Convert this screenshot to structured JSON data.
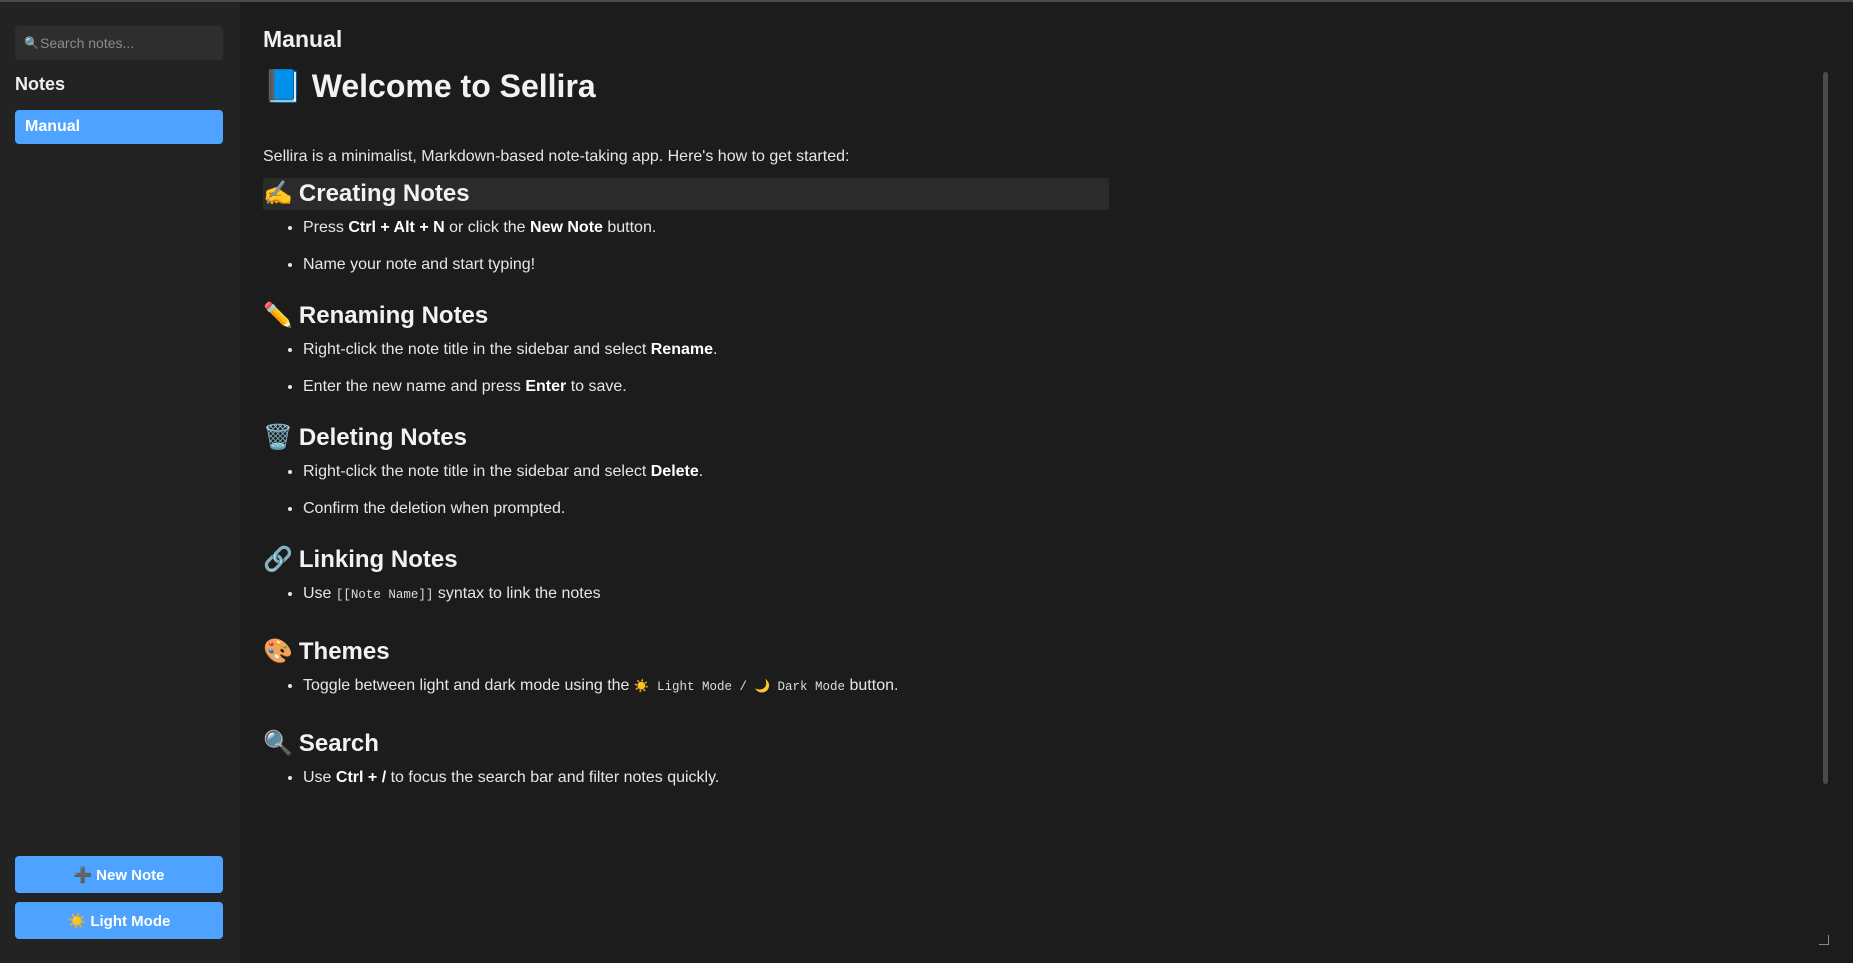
{
  "sidebar": {
    "search": {
      "placeholder": "Search notes...",
      "icon": "search-icon"
    },
    "heading": "Notes",
    "notes": [
      {
        "label": "Manual",
        "active": true
      }
    ],
    "new_note_button": {
      "icon": "plus-icon",
      "glyph": "➕",
      "label": "New Note"
    },
    "theme_button": {
      "icon": "sun-icon",
      "glyph": "☀️",
      "label": "Light Mode"
    }
  },
  "main": {
    "title": "Manual",
    "document": {
      "h1_glyph": "📘",
      "h1": "Welcome to Sellira",
      "intro": "Sellira is a minimalist, Markdown-based note-taking app. Here's how to get started:",
      "sections": [
        {
          "glyph": "✍️",
          "heading": "Creating Notes",
          "items": [
            [
              "Press ",
              {
                "b": "Ctrl + Alt + N"
              },
              " or click the ",
              {
                "b": "New Note"
              },
              " button."
            ],
            [
              "Name your note and start typing!"
            ]
          ]
        },
        {
          "glyph": "✏️",
          "heading": "Renaming Notes",
          "items": [
            [
              "Right-click the note title in the sidebar and select ",
              {
                "b": "Rename"
              },
              "."
            ],
            [
              "Enter the new name and press ",
              {
                "b": "Enter"
              },
              " to save."
            ]
          ]
        },
        {
          "glyph": "🗑️",
          "heading": "Deleting Notes",
          "items": [
            [
              "Right-click the note title in the sidebar and select ",
              {
                "b": "Delete"
              },
              "."
            ],
            [
              "Confirm the deletion when prompted."
            ]
          ]
        },
        {
          "glyph": "🔗",
          "heading": "Linking Notes",
          "items": [
            [
              "Use ",
              {
                "code": "[[Note Name]]"
              },
              " syntax to link the notes"
            ]
          ]
        },
        {
          "glyph": "🎨",
          "heading": "Themes",
          "items": [
            [
              "Toggle between light and dark mode using the ",
              {
                "code": "☀️ Light Mode / 🌙 Dark Mode"
              },
              " button."
            ]
          ]
        },
        {
          "glyph": "🔍",
          "heading": "Search",
          "items": [
            [
              "Use ",
              {
                "b": "Ctrl + /"
              },
              " to focus the search bar and filter notes quickly."
            ]
          ]
        }
      ]
    }
  },
  "colors": {
    "accent": "#4da3ff",
    "background": "#1c1c1c",
    "sidebar": "#232323",
    "text": "#e6e6e6"
  }
}
